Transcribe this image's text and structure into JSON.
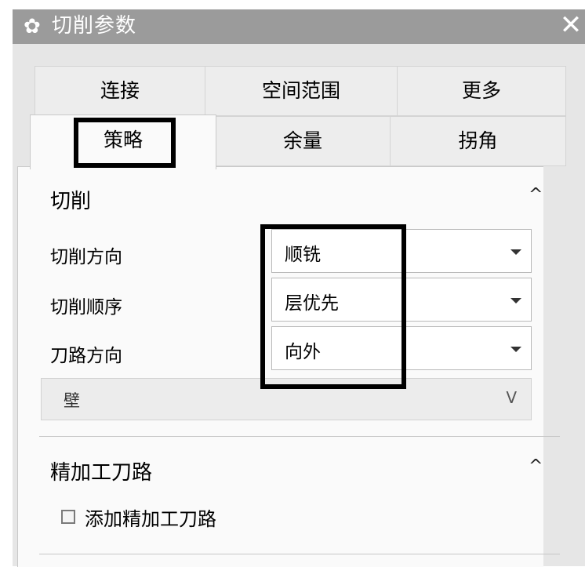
{
  "window": {
    "title": "切削参数",
    "close_glyph": "✕",
    "icon": "gear-icon"
  },
  "tabs": {
    "row1": [
      {
        "label": "连接"
      },
      {
        "label": "空间范围"
      },
      {
        "label": "更多"
      }
    ],
    "row2": [
      {
        "label": "策略",
        "active": true
      },
      {
        "label": "余量"
      },
      {
        "label": "拐角"
      }
    ]
  },
  "cut_section": {
    "title": "切削",
    "caret": "^",
    "rows": [
      {
        "label": "切削方向",
        "value": "顺铣"
      },
      {
        "label": "切削顺序",
        "value": "层优先"
      },
      {
        "label": "刀路方向",
        "value": "向外"
      }
    ],
    "wall": {
      "label": "壁",
      "chevron": "V"
    }
  },
  "finish_section": {
    "title": "精加工刀路",
    "caret": "^",
    "checkbox": {
      "label": "添加精加工刀路",
      "checked": false
    }
  }
}
